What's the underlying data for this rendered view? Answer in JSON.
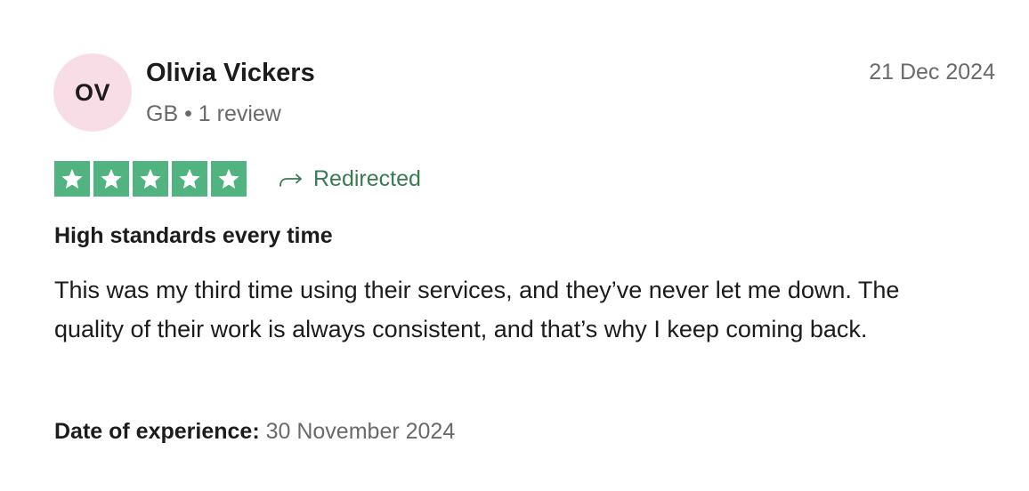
{
  "reviewer": {
    "initials": "OV",
    "name": "Olivia Vickers",
    "meta": "GB • 1 review",
    "avatar_color": "#f9dde6"
  },
  "review": {
    "date": "21 Dec 2024",
    "rating": 5,
    "rating_max": 5,
    "star_color": "#51b37f",
    "source_label": "Redirected",
    "source_icon": "redirect-arrow-icon",
    "title": "High standards every time",
    "body": "This was my third time using their services, and they’ve never let me down. The quality of their work is always consistent, and that’s why I keep coming back.",
    "experience_label": "Date of experience:",
    "experience_date": "30 November 2024"
  }
}
